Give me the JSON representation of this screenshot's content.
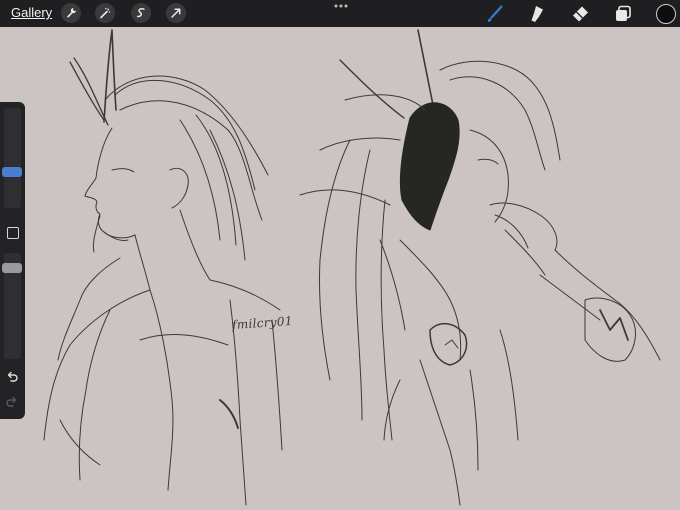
{
  "app": {
    "gallery_label": "Gallery",
    "left_tools": [
      "wrench-icon",
      "magic-wand-icon",
      "selection-icon",
      "transform-arrow-icon"
    ],
    "right_tools": [
      "brush-icon",
      "smudge-icon",
      "eraser-icon",
      "layers-icon"
    ],
    "current_color": "#0d0d0f",
    "accent_color": "#3d7bd8"
  },
  "sidebar": {
    "brush_size_level": 0.35,
    "opacity_level": 0.1
  },
  "canvas": {
    "signature": "fmilcry01"
  }
}
